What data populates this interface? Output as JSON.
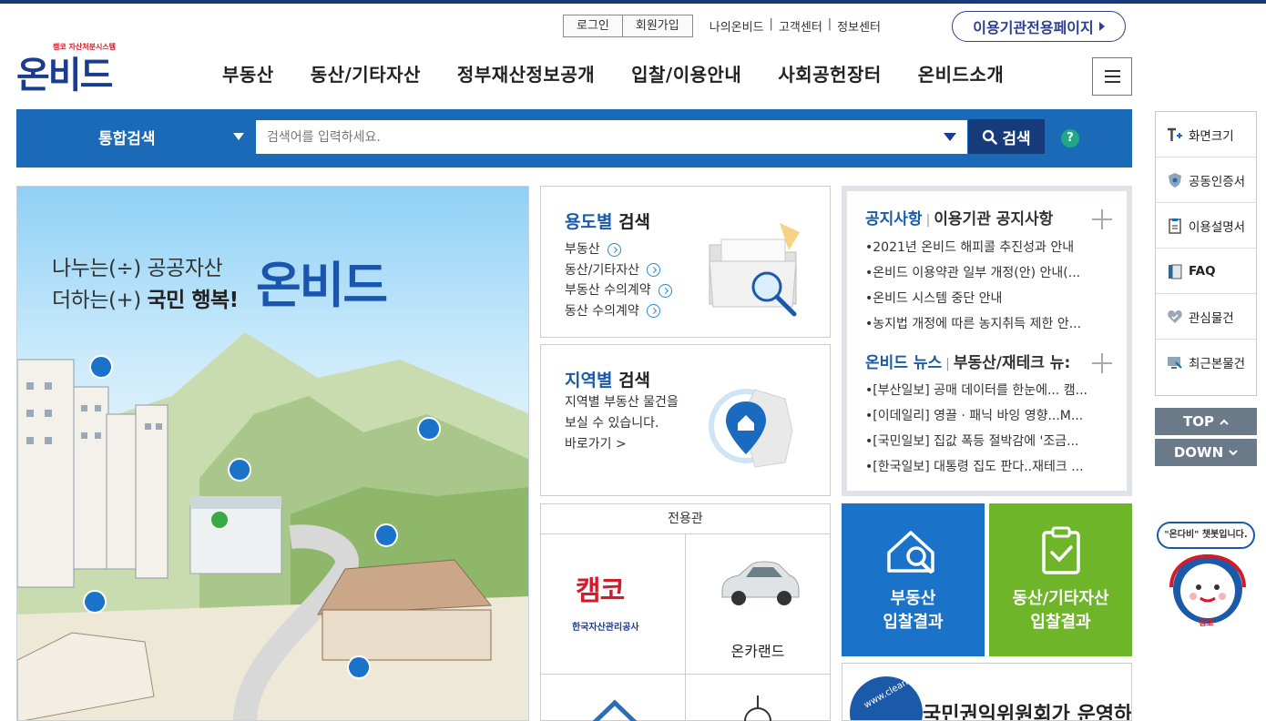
{
  "utility": {
    "login": "로그인",
    "signup": "회원가입",
    "links": [
      "나의온비드",
      "고객센터",
      "정보센터"
    ],
    "separator": "|",
    "institution_page": "이용기관전용페이지"
  },
  "logo": {
    "main": "온비드",
    "sub": "캠코 자산처분시스템"
  },
  "gnb": [
    "부동산",
    "동산/기타자산",
    "정부재산정보공개",
    "입찰/이용안내",
    "사회공헌장터",
    "온비드소개"
  ],
  "search": {
    "category": "통합검색",
    "placeholder": "검색어를 입력하세요.",
    "button": "검색",
    "help": "?"
  },
  "hero": {
    "line1": "나누는(÷) 공공자산",
    "line2_a": "더하는(+) ",
    "line2_b": "국민 행복!",
    "logo_text": "온비드"
  },
  "use_search": {
    "title_acc": "용도별",
    "title_rest": " 검색",
    "links": [
      "부동산",
      "동산/기타자산",
      "부동산 수의계약",
      "동산 수의계약"
    ]
  },
  "region_search": {
    "title_acc": "지역별",
    "title_rest": " 검색",
    "desc1": "지역별 부동산 물건을",
    "desc2": "보실 수 있습니다.",
    "go": "바로가기 >"
  },
  "dedicated": {
    "title": "전용관",
    "kamco_logo": "캠코",
    "kamco_sub": "한국자산관리공사",
    "oncarland": "온카랜드"
  },
  "notice": {
    "tab1": "공지사항",
    "tab2": "이용기관 공지사항",
    "items": [
      "2021년 온비드 해피콜 추진성과 안내",
      "온비드 이용약관 일부 개정(안) 안내(...",
      "온비드 시스템 중단 안내",
      "농지법 개정에 따른 농지취득 제한 안..."
    ],
    "news_tab1": "온비드 뉴스",
    "news_tab2": "부동산/재테크 뉴:",
    "news": [
      "[부산일보] 공매 데이터를 한눈에... 캠...",
      "[이데일리] 영끌 · 패닉 바잉 영향...M...",
      "[국민일보] 집값 폭등 절박감에 '조금...",
      "[한국일보] 대통령 집도 판다..재테크 ..."
    ]
  },
  "tiles": {
    "realestate_l1": "부동산",
    "realestate_l2": "입찰결과",
    "movable_l1": "동산/기타자산",
    "movable_l2": "입찰결과",
    "realestate_color": "#1a73c8",
    "movable_color": "#6fb529"
  },
  "banner": {
    "text": "국민권익위원회가 운영하는",
    "badge": "www.clean.go"
  },
  "quick_menu": {
    "items": [
      "화면크기",
      "공동인증서",
      "이용설명서",
      "FAQ",
      "관심물건",
      "최근본물건"
    ],
    "top": "TOP",
    "down": "DOWN"
  },
  "chatbot": {
    "bubble": "\"온다비\" 챗봇입니다.",
    "badge": "캠코"
  },
  "colors": {
    "navy": "#1a3c8c",
    "search_blue": "#1a6ab8",
    "search_button": "#173a7a",
    "help_green": "#1fa882"
  }
}
